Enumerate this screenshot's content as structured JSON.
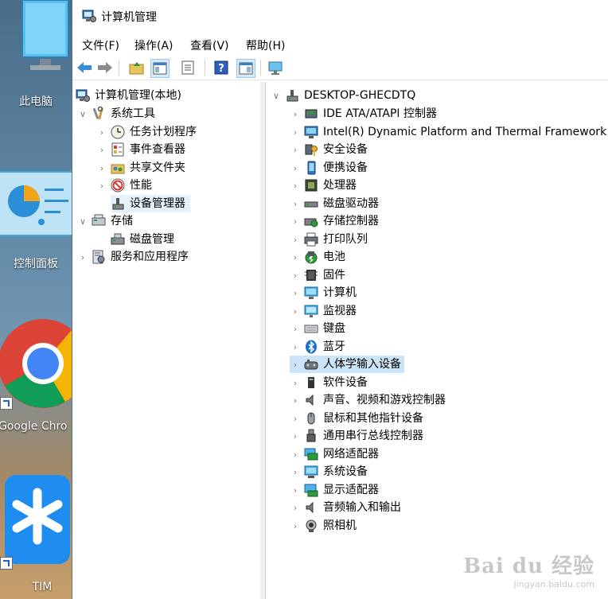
{
  "desktop": {
    "icons": [
      {
        "label": "此电脑"
      },
      {
        "label": "控制面板"
      },
      {
        "label": "Google Chro"
      },
      {
        "label": "TIM"
      }
    ]
  },
  "window": {
    "title": "计算机管理",
    "menu": [
      "文件(F)",
      "操作(A)",
      "查看(V)",
      "帮助(H)"
    ]
  },
  "left_tree": {
    "root": "计算机管理(本地)",
    "system_tools": "系统工具",
    "system_children": [
      "任务计划程序",
      "事件查看器",
      "共享文件夹",
      "性能",
      "设备管理器"
    ],
    "storage": "存储",
    "storage_children": [
      "磁盘管理"
    ],
    "services": "服务和应用程序"
  },
  "device_tree": {
    "root": "DESKTOP-GHECDTQ",
    "items": [
      {
        "label": "IDE ATA/ATAPI 控制器",
        "icon": "ide-controller-icon"
      },
      {
        "label": "Intel(R) Dynamic Platform and Thermal Framework",
        "icon": "framework-icon"
      },
      {
        "label": "安全设备",
        "icon": "security-key-icon"
      },
      {
        "label": "便携设备",
        "icon": "portable-device-icon"
      },
      {
        "label": "处理器",
        "icon": "cpu-icon"
      },
      {
        "label": "磁盘驱动器",
        "icon": "disk-drive-icon"
      },
      {
        "label": "存储控制器",
        "icon": "storage-controller-icon"
      },
      {
        "label": "打印队列",
        "icon": "printer-icon"
      },
      {
        "label": "电池",
        "icon": "battery-icon"
      },
      {
        "label": "固件",
        "icon": "firmware-icon"
      },
      {
        "label": "计算机",
        "icon": "computer-icon"
      },
      {
        "label": "监视器",
        "icon": "monitor-icon"
      },
      {
        "label": "键盘",
        "icon": "keyboard-icon"
      },
      {
        "label": "蓝牙",
        "icon": "bluetooth-icon"
      },
      {
        "label": "人体学输入设备",
        "icon": "hid-icon"
      },
      {
        "label": "软件设备",
        "icon": "software-device-icon"
      },
      {
        "label": "声音、视频和游戏控制器",
        "icon": "speaker-icon"
      },
      {
        "label": "鼠标和其他指针设备",
        "icon": "mouse-icon"
      },
      {
        "label": "通用串行总线控制器",
        "icon": "usb-icon"
      },
      {
        "label": "网络适配器",
        "icon": "network-adapter-icon"
      },
      {
        "label": "系统设备",
        "icon": "system-device-icon"
      },
      {
        "label": "显示适配器",
        "icon": "display-adapter-icon"
      },
      {
        "label": "音频输入和输出",
        "icon": "audio-io-icon"
      },
      {
        "label": "照相机",
        "icon": "camera-icon"
      }
    ]
  },
  "watermark": {
    "brand": "Bai du 经验",
    "url": "jingyan.baidu.com"
  }
}
